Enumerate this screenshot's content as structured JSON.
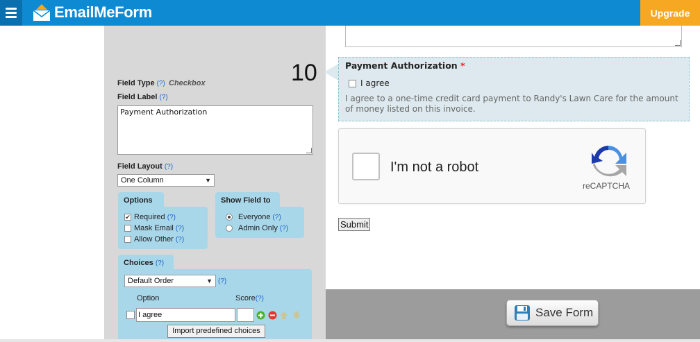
{
  "app": {
    "logo_text": "EmailMeForm",
    "upgrade_label": "Upgrade"
  },
  "left_panel": {
    "field_type_label": "Field Type",
    "field_type_help": "(?)",
    "field_type_value": "Checkbox",
    "field_label_label": "Field Label",
    "field_label_help": "(?)",
    "field_label_value": "Payment Authorization",
    "field_layout_label": "Field Layout",
    "field_layout_help": "(?)",
    "field_layout_value": "One Column",
    "options": {
      "title": "Options",
      "items": [
        {
          "label": "Required",
          "help": "(?)",
          "checked": true
        },
        {
          "label": "Mask Email",
          "help": "(?)",
          "checked": false
        },
        {
          "label": "Allow Other",
          "help": "(?)",
          "checked": false
        }
      ]
    },
    "show_field": {
      "title": "Show Field to",
      "items": [
        {
          "label": "Everyone",
          "help": "(?)",
          "selected": true
        },
        {
          "label": "Admin Only",
          "help": "(?)",
          "selected": false
        }
      ]
    },
    "choices": {
      "title": "Choices",
      "help": "(?)",
      "order_value": "Default Order",
      "order_help": "(?)",
      "col_option": "Option",
      "col_score": "Score",
      "col_score_help": "(?)",
      "row_value": "I agree",
      "import_label": "Import predefined choices"
    }
  },
  "preview": {
    "field_number": "10",
    "field_title": "Payment Authorization",
    "required_mark": "*",
    "checkbox_label": "I agree",
    "description": "I agree to a one-time credit card payment to Randy's Lawn Care for the amount of money listed on this invoice.",
    "recaptcha_text": "I'm not a robot",
    "recaptcha_brand": "reCAPTCHA",
    "submit_label": "Submit"
  },
  "footer": {
    "save_label": "Save Form"
  },
  "colors": {
    "topbar": "#0e8ad3",
    "upgrade": "#f6a822",
    "panel_bg": "#d8d8d8",
    "tab_bg": "#a9d7ea",
    "field_highlight": "#dde9ee"
  }
}
